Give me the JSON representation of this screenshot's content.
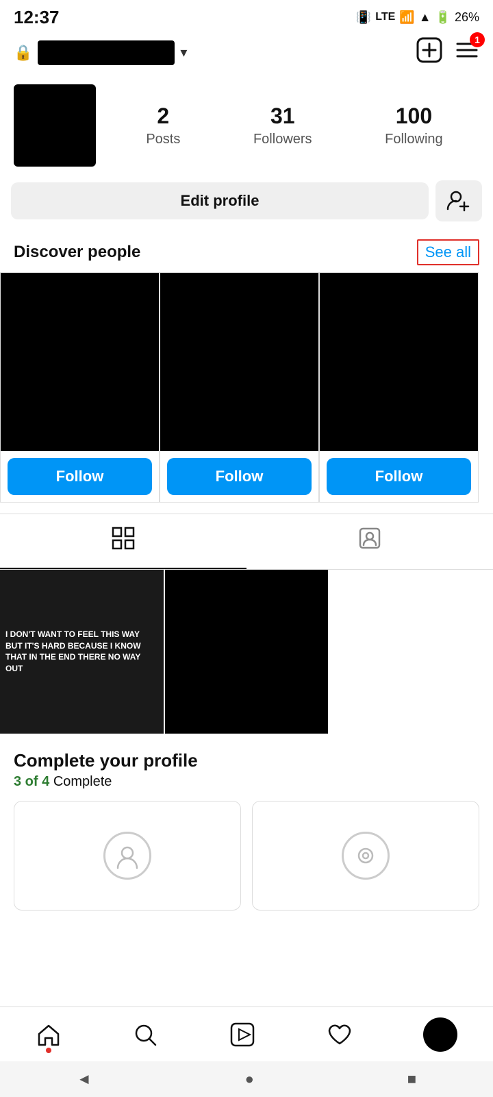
{
  "statusBar": {
    "time": "12:37",
    "battery": "26%"
  },
  "topNav": {
    "lockIconUnicode": "🔒",
    "addPostLabel": "➕",
    "menuLabel": "☰",
    "notificationCount": "1"
  },
  "profile": {
    "postsCount": "2",
    "postsLabel": "Posts",
    "followersCount": "31",
    "followersLabel": "Followers",
    "followingCount": "100",
    "followingLabel": "Following"
  },
  "buttons": {
    "editProfile": "Edit profile",
    "seeAll": "See all"
  },
  "discoverPeople": {
    "title": "Discover people",
    "seeAll": "See all"
  },
  "followButtons": [
    {
      "label": "Follow"
    },
    {
      "label": "Follow"
    },
    {
      "label": "Follow"
    }
  ],
  "completeProfile": {
    "title": "Complete your profile",
    "progress": "3 of 4",
    "progressSuffix": " Complete"
  },
  "bottomNav": {
    "home": "⌂",
    "search": "🔍",
    "reels": "▶",
    "likes": "♡"
  },
  "androidNav": {
    "back": "◄",
    "home": "●",
    "recent": "■"
  },
  "postText": "I DON'T WANT TO FEEL THIS WAY BUT IT'S HARD BECAUSE I KNOW THAT IN THE END THERE NO WAY OUT"
}
